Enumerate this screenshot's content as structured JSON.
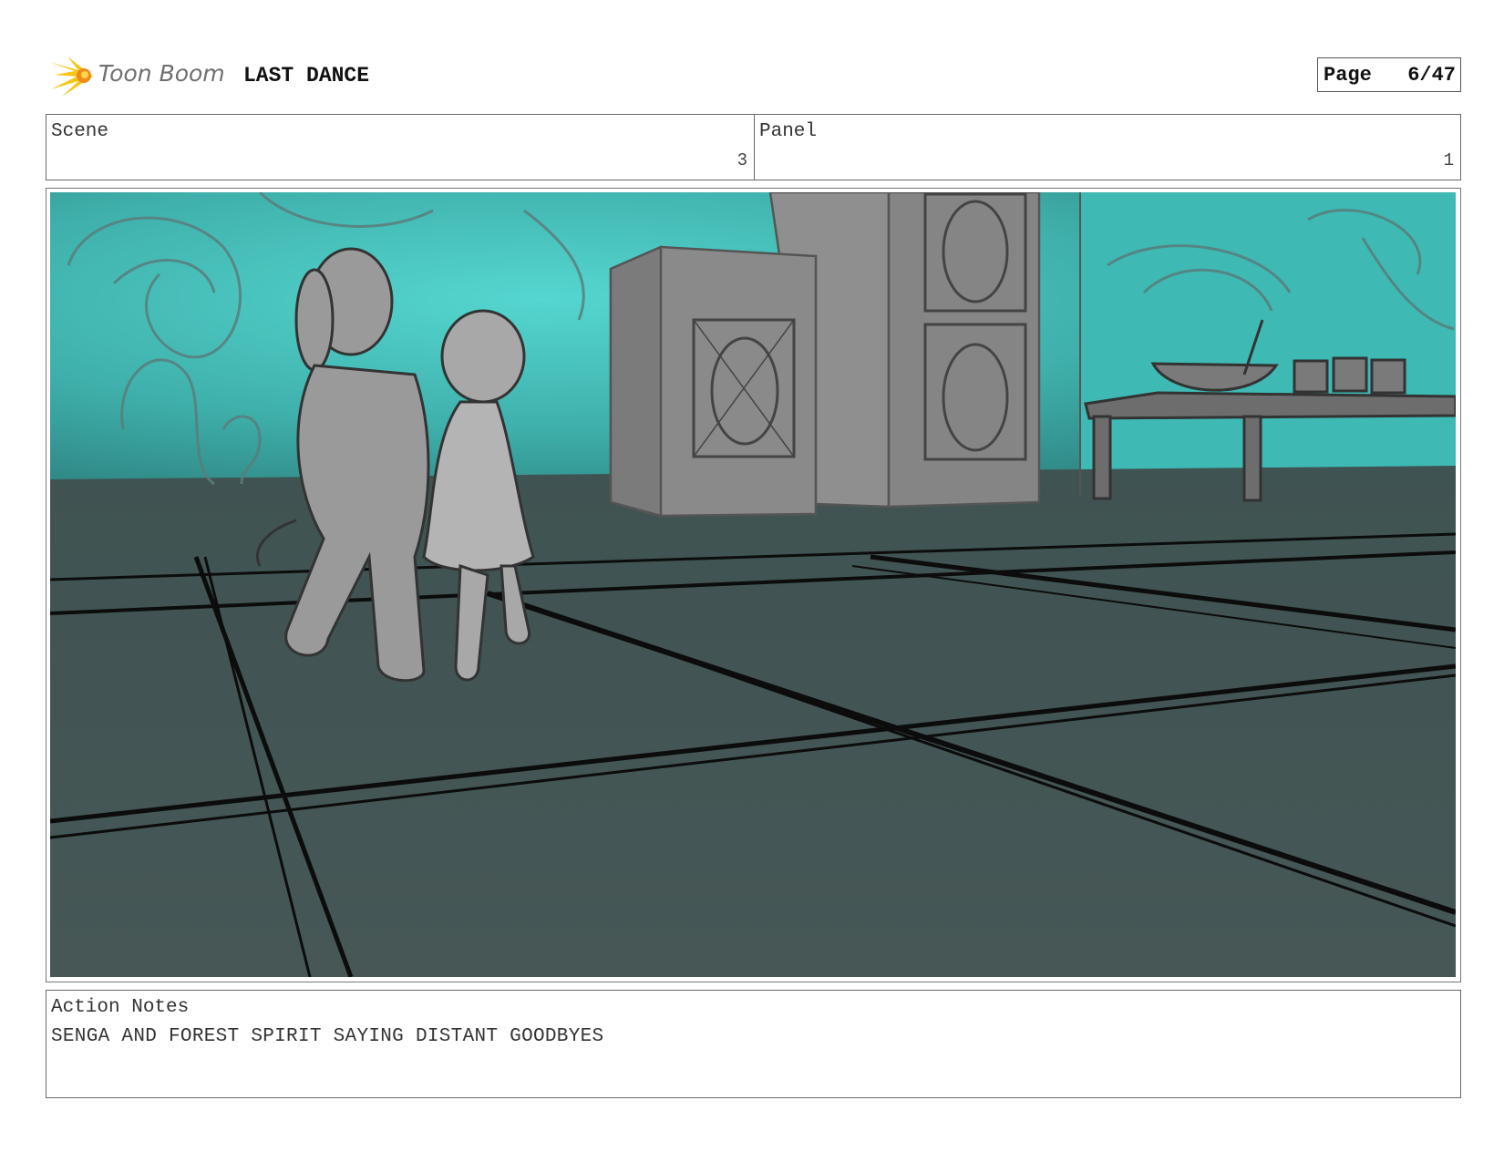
{
  "header": {
    "logo_text": "Toon Boom",
    "title": "LAST DANCE",
    "page_label": "Page",
    "page_number": "6/47"
  },
  "scene": {
    "label": "Scene",
    "value": "3"
  },
  "panel": {
    "label": "Panel",
    "value": "1"
  },
  "action_notes": {
    "label": "Action Notes",
    "text": "SENGA AND FOREST SPIRIT SAYING DISTANT GOODBYES"
  },
  "colors": {
    "wall_teal": "#4ecbc6",
    "floor": "#425352",
    "speaker_gray": "#8a8a8a",
    "logo_yellow": "#f5c518",
    "logo_orange": "#f08a1c"
  }
}
